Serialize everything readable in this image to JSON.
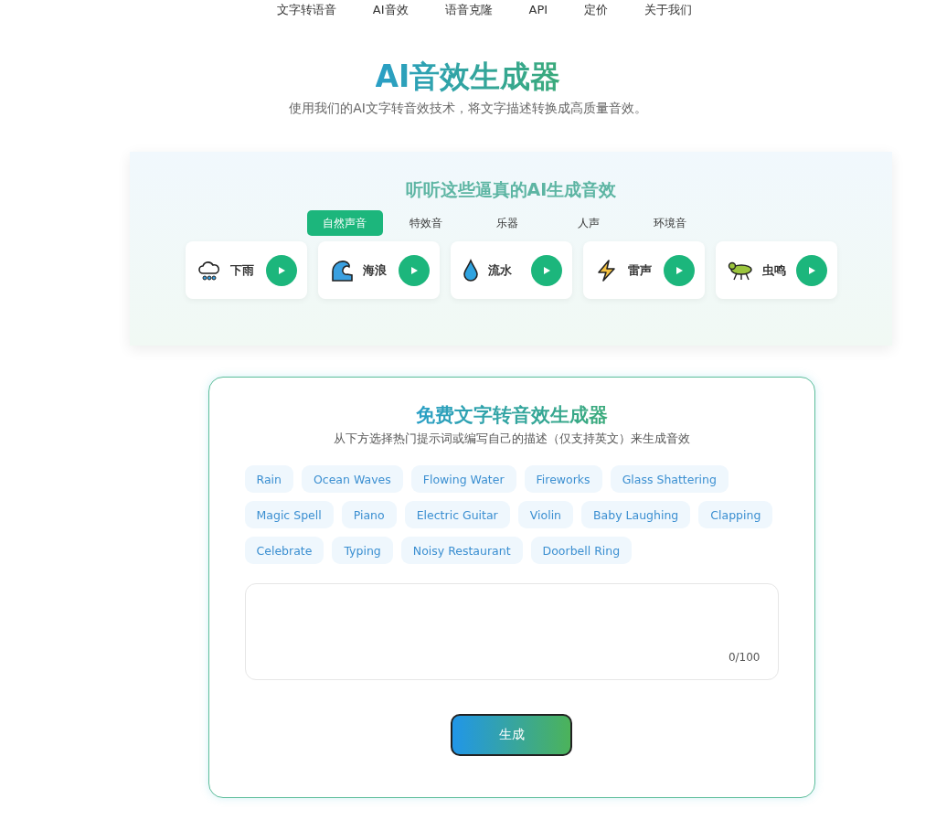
{
  "nav": [
    "文字转语音",
    "AI音效",
    "语音克隆",
    "API",
    "定价",
    "关于我们"
  ],
  "hero": {
    "title": "AI音效生成器",
    "subtitle": "使用我们的AI文字转音效技术，将文字描述转换成高质量音效。"
  },
  "samples": {
    "title": "听听这些逼真的AI生成音效",
    "tabs": [
      {
        "label": "自然声音",
        "selected": true
      },
      {
        "label": "特效音",
        "selected": false
      },
      {
        "label": "乐器",
        "selected": false
      },
      {
        "label": "人声",
        "selected": false
      },
      {
        "label": "环境音",
        "selected": false
      }
    ],
    "sounds": [
      "下雨",
      "海浪",
      "流水",
      "雷声",
      "虫鸣"
    ]
  },
  "generator": {
    "title": "免费文字转音效生成器",
    "subtitle": "从下方选择热门提示词或编写自己的描述（仅支持英文）来生成音效",
    "prompts": [
      "Rain",
      "Ocean Waves",
      "Flowing Water",
      "Fireworks",
      "Glass Shattering",
      "Magic Spell",
      "Piano",
      "Electric Guitar",
      "Violin",
      "Baby Laughing",
      "Clapping",
      "Celebrate",
      "Typing",
      "Noisy Restaurant",
      "Doorbell Ring"
    ],
    "counter": "0/100",
    "button": "生成"
  }
}
